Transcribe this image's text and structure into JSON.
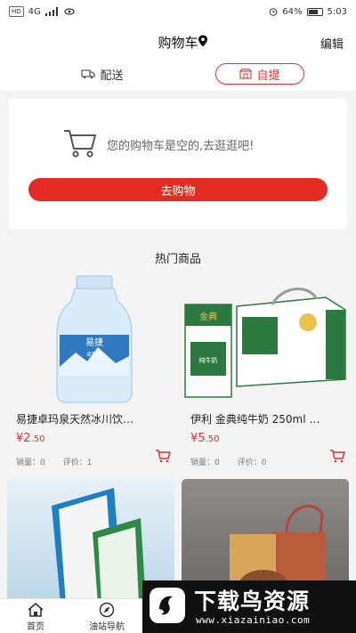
{
  "status_bar": {
    "left_badge": "HD",
    "network": "4G",
    "battery_percent": "64%",
    "time": "5:03"
  },
  "header": {
    "title": "购物车",
    "edit_label": "编辑"
  },
  "mode_tabs": {
    "delivery_label": "配送",
    "pickup_label": "自提",
    "selected": "pickup"
  },
  "cart": {
    "empty_text": "您的购物车是空的,去逛逛吧!",
    "go_shopping_label": "去购物"
  },
  "section_title": "热门商品",
  "products": [
    {
      "name": "易捷卓玛泉天然冰川饮…",
      "currency": "¥",
      "price_int": "2",
      "price_dec": ".50",
      "sales": "销量：0",
      "rating": "评价：1"
    },
    {
      "name": "伊利 金典纯牛奶 250ml …",
      "currency": "¥",
      "price_int": "5",
      "price_dec": ".50",
      "sales": "销量：0",
      "rating": "评价：0"
    }
  ],
  "product_images": [
    {
      "brand": "易捷",
      "sub": "卓玛泉"
    },
    {
      "brand": "金典",
      "sub": "纯牛奶"
    }
  ],
  "tabbar": {
    "home_label": "首页",
    "station_nav_label": "油站导航"
  },
  "watermark": {
    "title": "下载鸟资源",
    "url": "www.xiazainiao.com"
  },
  "colors": {
    "accent": "#e52c24",
    "price": "#d33333"
  }
}
